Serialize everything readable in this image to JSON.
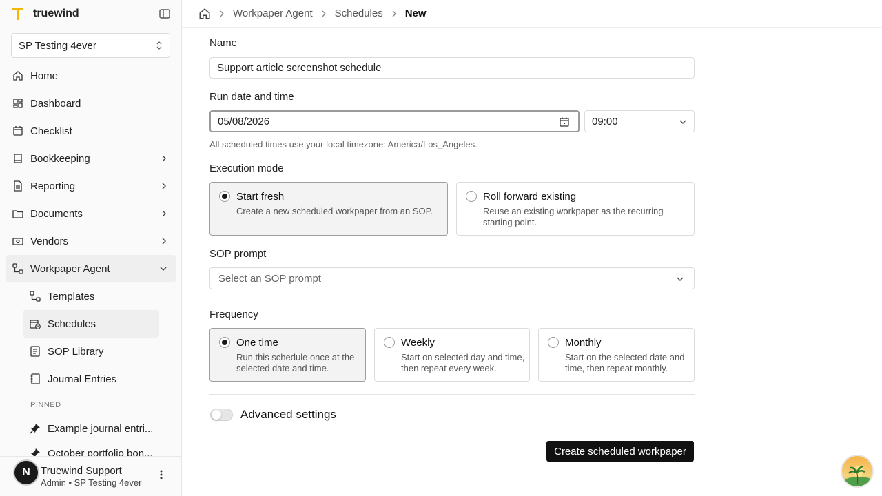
{
  "brand": {
    "name": "truewind",
    "accent": "#f5b800"
  },
  "org_select": {
    "value": "SP Testing 4ever"
  },
  "nav": {
    "items": [
      {
        "label": "Home",
        "icon": "home-icon"
      },
      {
        "label": "Dashboard",
        "icon": "dashboard-icon"
      },
      {
        "label": "Checklist",
        "icon": "calendar-check-icon"
      },
      {
        "label": "Bookkeeping",
        "icon": "book-icon"
      },
      {
        "label": "Reporting",
        "icon": "report-icon"
      },
      {
        "label": "Documents",
        "icon": "folder-icon"
      },
      {
        "label": "Vendors",
        "icon": "vendor-icon"
      },
      {
        "label": "Workpaper Agent",
        "icon": "workflow-icon"
      }
    ],
    "sub_items": [
      {
        "label": "Templates",
        "icon": "workflow-icon"
      },
      {
        "label": "Schedules",
        "icon": "calendar-clock-icon"
      },
      {
        "label": "SOP Library",
        "icon": "library-icon"
      },
      {
        "label": "Journal Entries",
        "icon": "journal-icon"
      }
    ],
    "pinned_label": "PINNED",
    "pinned": [
      {
        "label": "Example journal entri...",
        "icon": "pin-icon"
      },
      {
        "label": "October portfolio bon...",
        "icon": "pin-icon"
      }
    ]
  },
  "user": {
    "initial": "N",
    "name": "Truewind Support",
    "role": "Admin • SP Testing 4ever"
  },
  "breadcrumb": [
    "Workpaper Agent",
    "Schedules",
    "New"
  ],
  "form": {
    "name_label": "Name",
    "name_value": "Support article screenshot schedule",
    "run_label": "Run date and time",
    "date_value": "05/08/2026",
    "time_value": "09:00",
    "timezone_hint": "All scheduled times use your local timezone: America/Los_Angeles.",
    "execution_label": "Execution mode",
    "execution_options": [
      {
        "title": "Start fresh",
        "desc": "Create a new scheduled workpaper from an SOP.",
        "selected": true
      },
      {
        "title": "Roll forward existing",
        "desc": "Reuse an existing workpaper as the recurring starting point.",
        "selected": false
      }
    ],
    "sop_label": "SOP prompt",
    "sop_placeholder": "Select an SOP prompt",
    "frequency_label": "Frequency",
    "frequency_options": [
      {
        "title": "One time",
        "desc": "Run this schedule once at the selected date and time.",
        "selected": true
      },
      {
        "title": "Weekly",
        "desc": "Start on selected day and time, then repeat every week.",
        "selected": false
      },
      {
        "title": "Monthly",
        "desc": "Start on the selected date and time, then repeat monthly.",
        "selected": false
      }
    ],
    "advanced_label": "Advanced settings",
    "submit_label": "Create scheduled workpaper"
  }
}
